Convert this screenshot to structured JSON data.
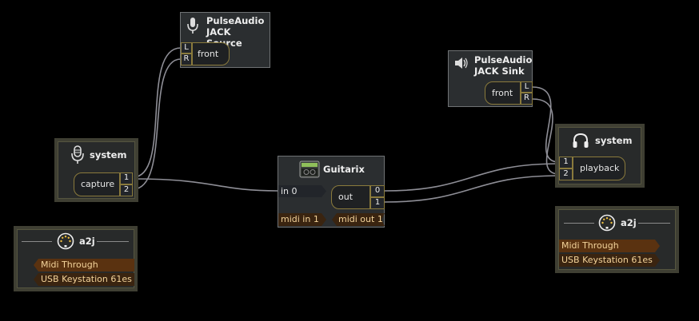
{
  "nodes": {
    "pa_source": {
      "title_line1": "PulseAudio",
      "title_line2": "JACK Source",
      "port_label": "front",
      "ports": [
        "L",
        "R"
      ]
    },
    "pa_sink": {
      "title_line1": "PulseAudio",
      "title_line2": "JACK Sink",
      "port_label": "front",
      "ports": [
        "L",
        "R"
      ]
    },
    "system_capture": {
      "title": "system",
      "port_label": "capture",
      "ports": [
        "1",
        "2"
      ]
    },
    "system_playback": {
      "title": "system",
      "port_label": "playback",
      "ports": [
        "1",
        "2"
      ]
    },
    "guitarix": {
      "title": "Guitarix",
      "in_port": "in 0",
      "out_label": "out",
      "out_ports": [
        "0",
        "1"
      ],
      "midi_in": "midi in 1",
      "midi_out": "midi out 1"
    },
    "a2j_left": {
      "title": "a2j",
      "ports": [
        "Midi Through",
        "USB Keystation 61es"
      ]
    },
    "a2j_right": {
      "title": "a2j",
      "ports": [
        "Midi Through",
        "USB Keystation 61es"
      ]
    }
  },
  "colors": {
    "background": "#000000",
    "box": "#2b2e30",
    "wire": "#8e8e96",
    "port_border": "#8a7a3c",
    "midi_port": "#5a3210"
  },
  "icons": {
    "mic": "microphone-icon",
    "speaker": "speaker-icon",
    "headphones": "headphones-icon",
    "midi": "midi-din-icon",
    "amp": "amplifier-icon"
  }
}
